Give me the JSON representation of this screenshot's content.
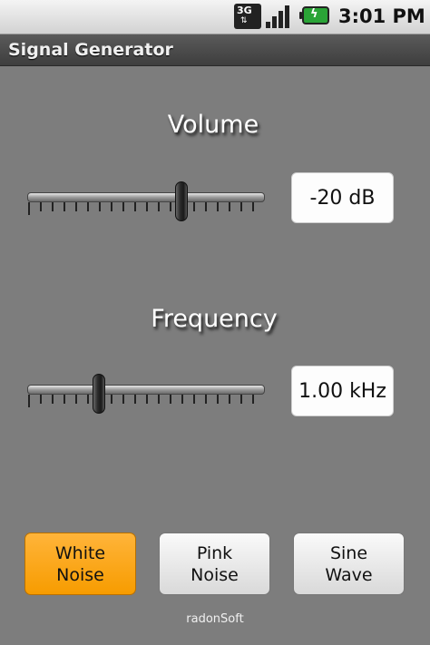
{
  "status_bar": {
    "network_type": "3G",
    "network_icon": "3g-data-icon",
    "signal_icon": "signal-strength-icon",
    "battery_icon": "battery-charging-icon",
    "battery_color": "#2aa437",
    "time": "3:01 PM"
  },
  "app": {
    "title": "Signal Generator"
  },
  "volume": {
    "label": "Volume",
    "value": "-20 dB",
    "slider_fraction": 0.65
  },
  "frequency": {
    "label": "Frequency",
    "value": "1.00 kHz",
    "slider_fraction": 0.3
  },
  "noise_buttons": [
    {
      "line1": "White",
      "line2": "Noise",
      "selected": true
    },
    {
      "line1": "Pink",
      "line2": "Noise",
      "selected": false
    },
    {
      "line1": "Sine",
      "line2": "Wave",
      "selected": false
    }
  ],
  "colors": {
    "accent_selected": "#f79c00",
    "background": "#7d7d7d"
  },
  "footer": {
    "text": "radonSoft"
  }
}
